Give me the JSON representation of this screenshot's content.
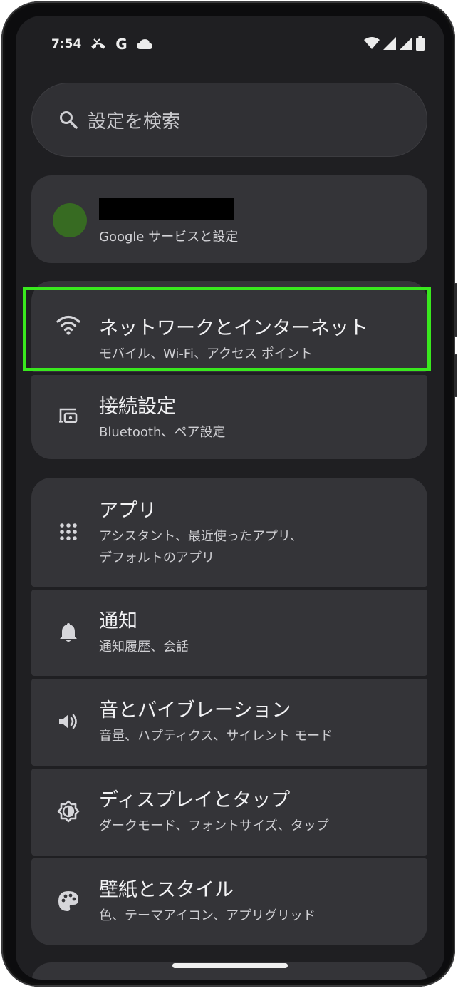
{
  "status_bar": {
    "time": "7:54",
    "icons_left": [
      "missed-call-icon",
      "google-icon",
      "cloud-icon"
    ],
    "icons_right": [
      "wifi-icon",
      "signal-icon",
      "signal-icon",
      "battery-icon"
    ],
    "google_letter": "G"
  },
  "search": {
    "placeholder": "設定を検索"
  },
  "account": {
    "subtitle": "Google サービスと設定",
    "avatar_color": "#376b22"
  },
  "settings_items": [
    {
      "title": "ネットワークとインターネット",
      "desc": "モバイル、Wi-Fi、アクセス ポイント",
      "icon": "wifi-icon"
    },
    {
      "title": "接続設定",
      "desc": "Bluetooth、ペア設定",
      "icon": "connected-devices-icon"
    },
    {
      "title": "アプリ",
      "desc": "アシスタント、最近使ったアプリ、",
      "desc2": "デフォルトのアプリ",
      "icon": "apps-grid-icon"
    },
    {
      "title": "通知",
      "desc": "通知履歴、会話",
      "icon": "bell-icon"
    },
    {
      "title": "音とバイブレーション",
      "desc": "音量、ハプティクス、サイレント モード",
      "icon": "speaker-icon"
    },
    {
      "title": "ディスプレイとタップ",
      "desc": "ダークモード、フォントサイズ、タップ",
      "icon": "brightness-icon"
    },
    {
      "title": "壁紙とスタイル",
      "desc": "色、テーマアイコン、アプリグリッド",
      "icon": "palette-icon"
    }
  ],
  "colors": {
    "highlight": "#39e81e",
    "background": "#1f1f22",
    "card": "#343438"
  }
}
